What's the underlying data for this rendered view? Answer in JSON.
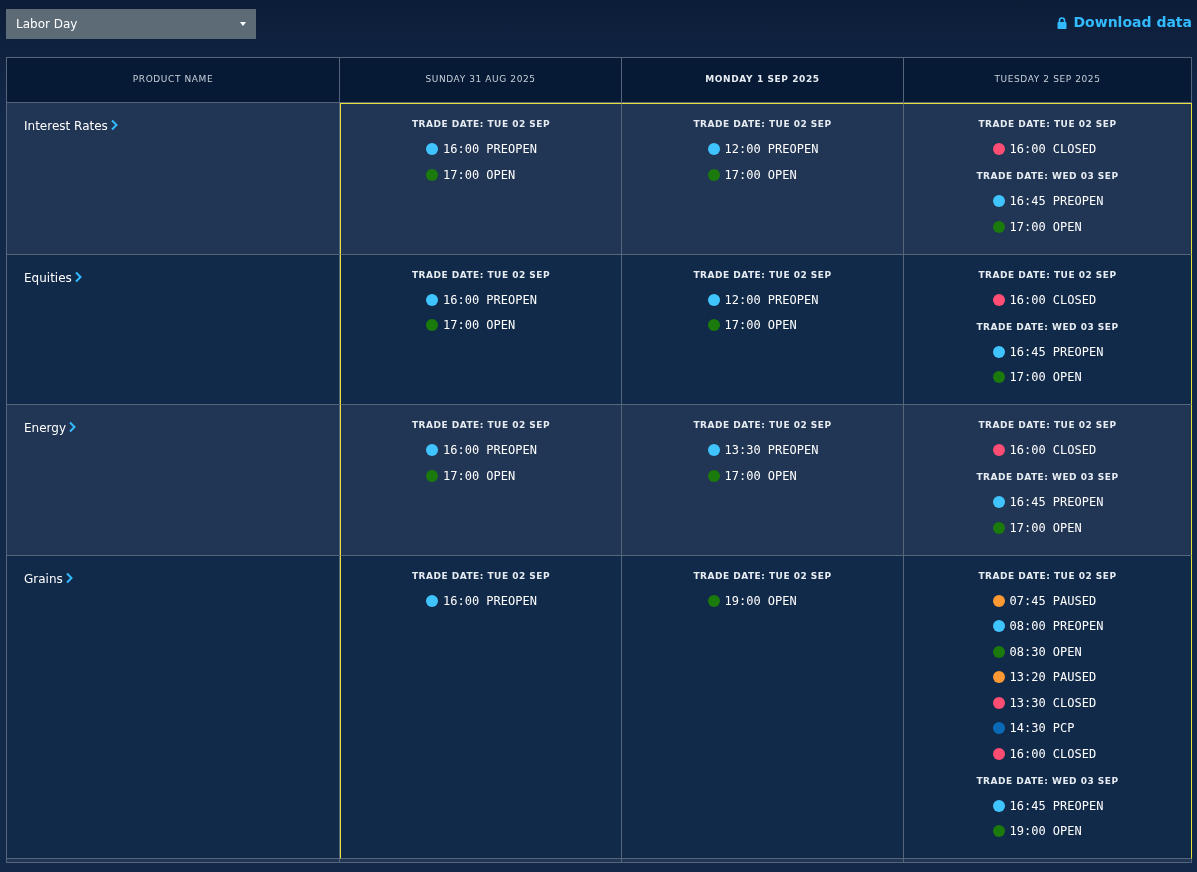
{
  "holiday_select": {
    "value": "Labor Day"
  },
  "download_link": {
    "label": "Download data"
  },
  "table": {
    "columns": [
      {
        "label": "PRODUCT NAME",
        "today": false
      },
      {
        "label": "SUNDAY 31 AUG 2025",
        "today": false
      },
      {
        "label": "MONDAY 1 SEP 2025",
        "today": true
      },
      {
        "label": "TUESDAY 2 SEP 2025",
        "today": false
      }
    ],
    "rows": [
      {
        "product": "Interest Rates",
        "days": [
          [
            {
              "trade_date": "TRADE DATE: TUE 02 SEP",
              "events": [
                {
                  "time": "16:00",
                  "status": "PREOPEN",
                  "color": "#40c4ff"
                },
                {
                  "time": "17:00",
                  "status": "OPEN",
                  "color": "#1b7a0c"
                }
              ]
            }
          ],
          [
            {
              "trade_date": "TRADE DATE: TUE 02 SEP",
              "events": [
                {
                  "time": "12:00",
                  "status": "PREOPEN",
                  "color": "#40c4ff"
                },
                {
                  "time": "17:00",
                  "status": "OPEN",
                  "color": "#1b7a0c"
                }
              ]
            }
          ],
          [
            {
              "trade_date": "TRADE DATE: TUE 02 SEP",
              "events": [
                {
                  "time": "16:00",
                  "status": "CLOSED",
                  "color": "#ff4d73"
                }
              ]
            },
            {
              "trade_date": "TRADE DATE: WED 03 SEP",
              "events": [
                {
                  "time": "16:45",
                  "status": "PREOPEN",
                  "color": "#40c4ff"
                },
                {
                  "time": "17:00",
                  "status": "OPEN",
                  "color": "#1b7a0c"
                }
              ]
            }
          ]
        ]
      },
      {
        "product": "Equities",
        "days": [
          [
            {
              "trade_date": "TRADE DATE: TUE 02 SEP",
              "events": [
                {
                  "time": "16:00",
                  "status": "PREOPEN",
                  "color": "#40c4ff"
                },
                {
                  "time": "17:00",
                  "status": "OPEN",
                  "color": "#1b7a0c"
                }
              ]
            }
          ],
          [
            {
              "trade_date": "TRADE DATE: TUE 02 SEP",
              "events": [
                {
                  "time": "12:00",
                  "status": "PREOPEN",
                  "color": "#40c4ff"
                },
                {
                  "time": "17:00",
                  "status": "OPEN",
                  "color": "#1b7a0c"
                }
              ]
            }
          ],
          [
            {
              "trade_date": "TRADE DATE: TUE 02 SEP",
              "events": [
                {
                  "time": "16:00",
                  "status": "CLOSED",
                  "color": "#ff4d73"
                }
              ]
            },
            {
              "trade_date": "TRADE DATE: WED 03 SEP",
              "events": [
                {
                  "time": "16:45",
                  "status": "PREOPEN",
                  "color": "#40c4ff"
                },
                {
                  "time": "17:00",
                  "status": "OPEN",
                  "color": "#1b7a0c"
                }
              ]
            }
          ]
        ]
      },
      {
        "product": "Energy",
        "days": [
          [
            {
              "trade_date": "TRADE DATE: TUE 02 SEP",
              "events": [
                {
                  "time": "16:00",
                  "status": "PREOPEN",
                  "color": "#40c4ff"
                },
                {
                  "time": "17:00",
                  "status": "OPEN",
                  "color": "#1b7a0c"
                }
              ]
            }
          ],
          [
            {
              "trade_date": "TRADE DATE: TUE 02 SEP",
              "events": [
                {
                  "time": "13:30",
                  "status": "PREOPEN",
                  "color": "#40c4ff"
                },
                {
                  "time": "17:00",
                  "status": "OPEN",
                  "color": "#1b7a0c"
                }
              ]
            }
          ],
          [
            {
              "trade_date": "TRADE DATE: TUE 02 SEP",
              "events": [
                {
                  "time": "16:00",
                  "status": "CLOSED",
                  "color": "#ff4d73"
                }
              ]
            },
            {
              "trade_date": "TRADE DATE: WED 03 SEP",
              "events": [
                {
                  "time": "16:45",
                  "status": "PREOPEN",
                  "color": "#40c4ff"
                },
                {
                  "time": "17:00",
                  "status": "OPEN",
                  "color": "#1b7a0c"
                }
              ]
            }
          ]
        ]
      },
      {
        "product": "Grains",
        "days": [
          [
            {
              "trade_date": "TRADE DATE: TUE 02 SEP",
              "events": [
                {
                  "time": "16:00",
                  "status": "PREOPEN",
                  "color": "#40c4ff"
                }
              ]
            }
          ],
          [
            {
              "trade_date": "TRADE DATE: TUE 02 SEP",
              "events": [
                {
                  "time": "19:00",
                  "status": "OPEN",
                  "color": "#1b7a0c"
                }
              ]
            }
          ],
          [
            {
              "trade_date": "TRADE DATE: TUE 02 SEP",
              "events": [
                {
                  "time": "07:45",
                  "status": "PAUSED",
                  "color": "#ff9933"
                },
                {
                  "time": "08:00",
                  "status": "PREOPEN",
                  "color": "#40c4ff"
                },
                {
                  "time": "08:30",
                  "status": "OPEN",
                  "color": "#1b7a0c"
                },
                {
                  "time": "13:20",
                  "status": "PAUSED",
                  "color": "#ff9933"
                },
                {
                  "time": "13:30",
                  "status": "CLOSED",
                  "color": "#ff4d73"
                },
                {
                  "time": "14:30",
                  "status": "PCP",
                  "color": "#0a6ab8"
                },
                {
                  "time": "16:00",
                  "status": "CLOSED",
                  "color": "#ff4d73"
                }
              ]
            },
            {
              "trade_date": "TRADE DATE: WED 03 SEP",
              "events": [
                {
                  "time": "16:45",
                  "status": "PREOPEN",
                  "color": "#40c4ff"
                },
                {
                  "time": "19:00",
                  "status": "OPEN",
                  "color": "#1b7a0c"
                }
              ]
            }
          ]
        ]
      }
    ]
  }
}
